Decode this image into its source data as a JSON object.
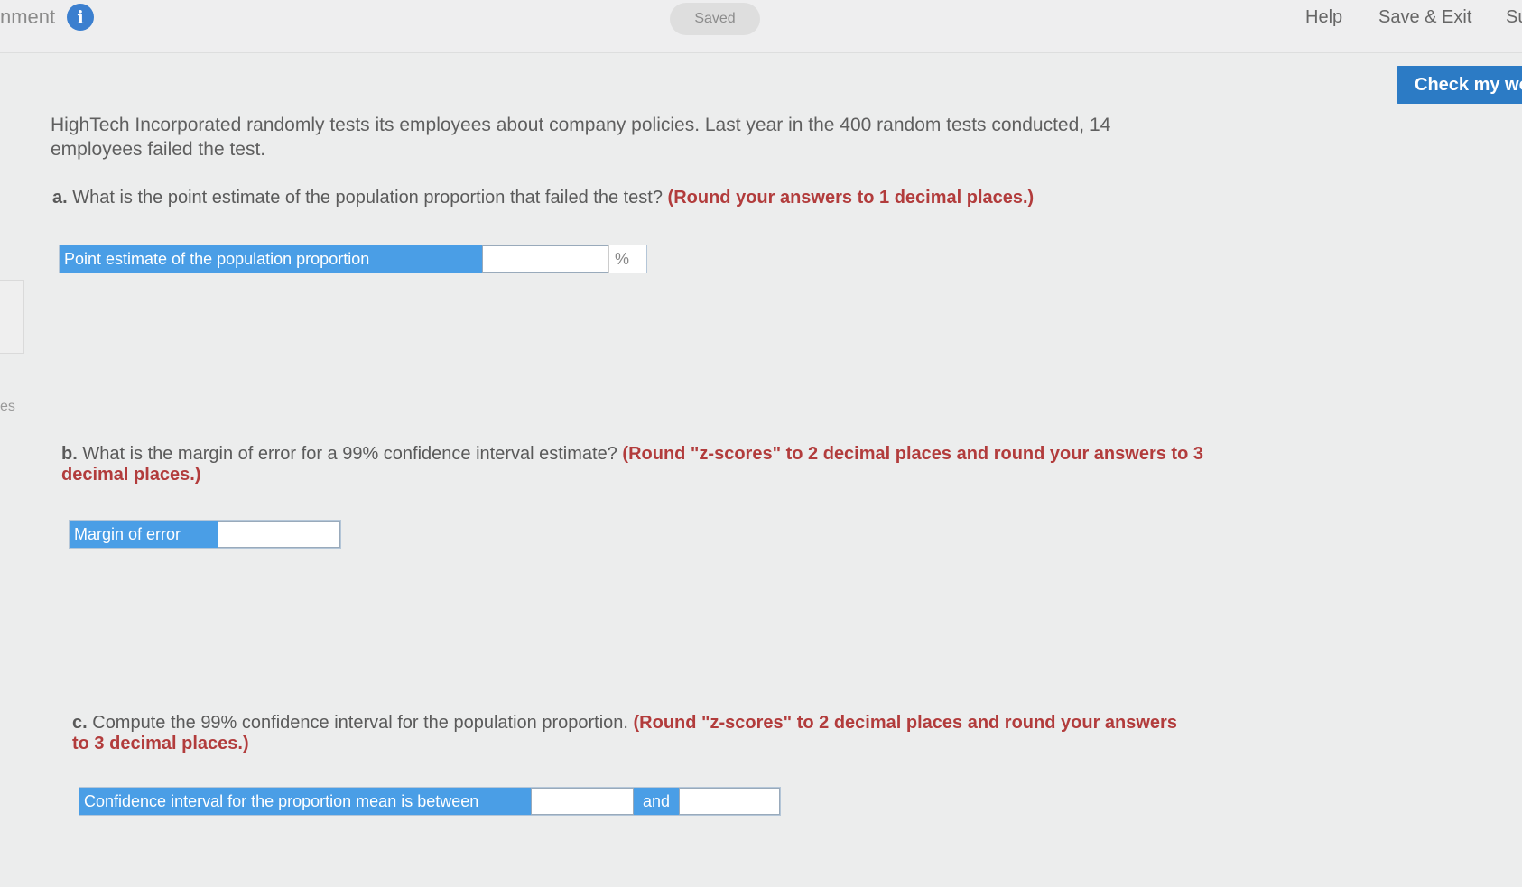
{
  "header": {
    "title": "nment",
    "saved_label": "Saved",
    "help_label": "Help",
    "save_exit_label": "Save & Exit",
    "submit_label": "Su",
    "check_button_label": "Check my wo"
  },
  "sidebar": {
    "label": "es"
  },
  "problem": {
    "text": "HighTech Incorporated randomly tests its employees about company policies. Last year in the 400 random tests conducted, 14 employees failed the test."
  },
  "questions": {
    "a": {
      "letter": "a.",
      "text": " What is the point estimate of the population proportion that failed the test? ",
      "note": "(Round your answers to 1 decimal places.)",
      "label": "Point estimate of the population proportion",
      "value": "",
      "unit": "%"
    },
    "b": {
      "letter": "b.",
      "text": " What is the margin of error for a 99% confidence interval estimate? ",
      "note": "(Round \"z-scores\" to 2 decimal places and round your answers to 3 decimal places.)",
      "label": "Margin of error",
      "value": ""
    },
    "c": {
      "letter": "c.",
      "text": " Compute the 99% confidence interval for the population proportion. ",
      "note": "(Round \"z-scores\" to 2 decimal places and round your answers to 3 decimal places.)",
      "label": "Confidence interval for the proportion mean is between",
      "value_low": "",
      "and_label": "and",
      "value_high": ""
    }
  },
  "colors": {
    "accent": "#2c7bc5",
    "label_bg": "#4a9ee6",
    "note": "#b23c3c"
  }
}
